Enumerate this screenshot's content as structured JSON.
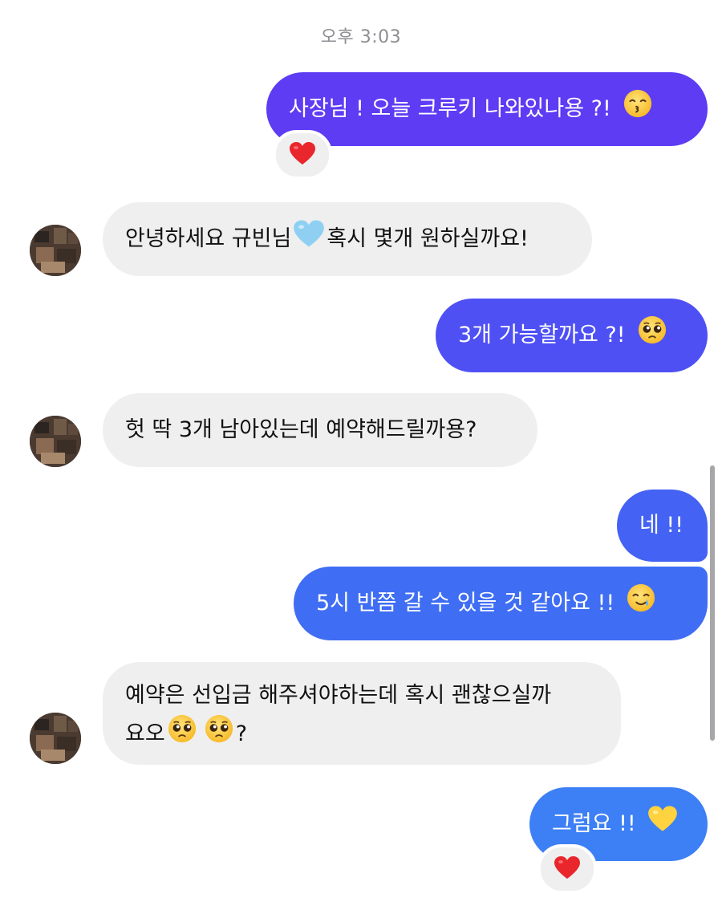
{
  "timestamp": "오후 3:03",
  "messages": [
    {
      "text": "사장님 ! 오늘 크루키 나와있나용 ?!",
      "emoji": "kissing-face-icon"
    },
    {
      "text": "안녕하세요 규빈님",
      "text2": "혹시 몇개 원하실까요!",
      "emoji": "light-blue-heart-icon"
    },
    {
      "text": "3개 가능할까요 ?!",
      "emoji": "pleading-face-icon"
    },
    {
      "text": "헛 딱 3개 남아있는데 예약해드릴까용?"
    },
    {
      "text": "네 !!"
    },
    {
      "text": "5시 반쯤 갈 수 있을 것 같아요 !!",
      "emoji": "smiling-face-with-tear-icon"
    },
    {
      "line1": "예약은 선입금 해주셔야하는데 혹시 괜찮으실까",
      "line2": "요오",
      "line2_end": "?",
      "emoji": "pleading-face-icon"
    },
    {
      "text": "그럼요 !!",
      "emoji": "yellow-heart-icon"
    }
  ],
  "reactions": [
    "red-heart-icon",
    "red-heart-icon"
  ],
  "colors": {
    "gradient_top": "#5b3df5",
    "gradient_bottom": "#3d7ff5",
    "incoming_bg": "#efefef",
    "heart_red": "#e8262b"
  }
}
